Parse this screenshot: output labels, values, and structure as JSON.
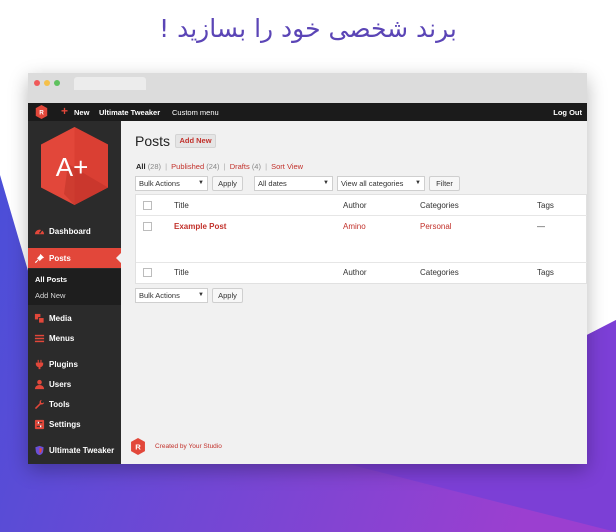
{
  "headline": "برند شخصی خود را بسازید !",
  "admin_bar": {
    "new_label": "New",
    "plus_glyph": "+",
    "tweaker_label": "Ultimate Tweaker",
    "custom_menu_label": "Custom menu",
    "logout_label": "Log Out",
    "logo_letter": "R"
  },
  "sidebar": {
    "logo_text": "A+",
    "items": [
      {
        "label": "Dashboard",
        "icon": "dashboard-icon"
      },
      {
        "label": "Posts",
        "icon": "pin-icon"
      },
      {
        "label": "Media",
        "icon": "media-icon"
      },
      {
        "label": "Menus",
        "icon": "menu-lines-icon"
      },
      {
        "label": "Plugins",
        "icon": "plugin-icon"
      },
      {
        "label": "Users",
        "icon": "user-icon"
      },
      {
        "label": "Tools",
        "icon": "wrench-icon"
      },
      {
        "label": "Settings",
        "icon": "settings-icon"
      },
      {
        "label": "Ultimate Tweaker",
        "icon": "shield-icon"
      }
    ],
    "submenu": [
      {
        "label": "All Posts"
      },
      {
        "label": "Add New"
      }
    ]
  },
  "content": {
    "page_title": "Posts",
    "add_new_label": "Add New",
    "filters": {
      "all": "All",
      "all_count": "(28)",
      "published": "Published",
      "published_count": "(24)",
      "drafts": "Drafts",
      "drafts_count": "(4)",
      "sort_view": "Sort View",
      "separator": "|"
    },
    "toolbar": {
      "bulk_actions": "Bulk Actions",
      "apply": "Apply",
      "all_dates": "All dates",
      "categories": "View all categories",
      "filter": "Filter"
    },
    "table": {
      "columns": [
        "Title",
        "Author",
        "Categories",
        "Tags"
      ],
      "rows": [
        {
          "title": "Example Post",
          "author": "Amino",
          "category": "Personal",
          "tags": "—"
        }
      ]
    },
    "footer_text": "Created by Your Studio"
  },
  "colors": {
    "accent": "#e2473a",
    "headline": "#5b45b6",
    "gradient_start": "#4a4fd8",
    "gradient_end": "#9b3fd0"
  }
}
